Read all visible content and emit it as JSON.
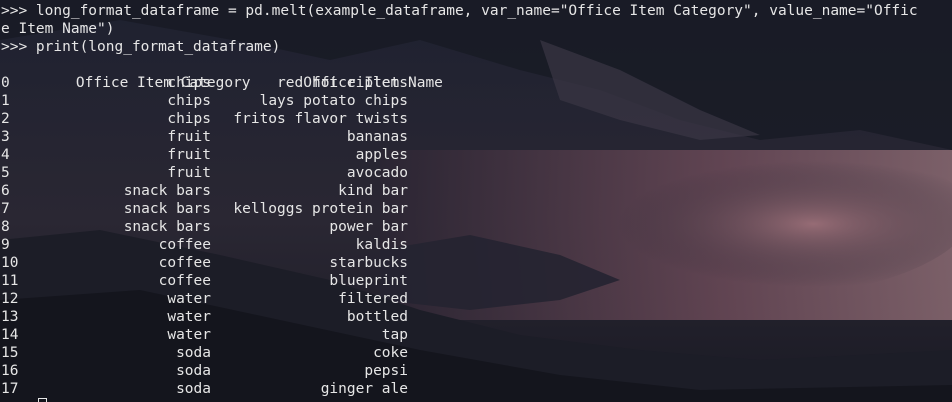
{
  "terminal": {
    "command_1_line_1": ">>> long_format_dataframe = pd.melt(example_dataframe, var_name=\"Office Item Category\", value_name=\"Offic",
    "command_1_line_2": "e Item Name\")",
    "command_2": ">>> print(long_format_dataframe)",
    "columns": [
      "Office Item Category",
      "Office Item Name"
    ],
    "rows": [
      {
        "index": "0",
        "category": "chips",
        "name": "red hot riplets"
      },
      {
        "index": "1",
        "category": "chips",
        "name": "lays potato chips"
      },
      {
        "index": "2",
        "category": "chips",
        "name": "fritos flavor twists"
      },
      {
        "index": "3",
        "category": "fruit",
        "name": "bananas"
      },
      {
        "index": "4",
        "category": "fruit",
        "name": "apples"
      },
      {
        "index": "5",
        "category": "fruit",
        "name": "avocado"
      },
      {
        "index": "6",
        "category": "snack bars",
        "name": "kind bar"
      },
      {
        "index": "7",
        "category": "snack bars",
        "name": "kelloggs protein bar"
      },
      {
        "index": "8",
        "category": "snack bars",
        "name": "power bar"
      },
      {
        "index": "9",
        "category": "coffee",
        "name": "kaldis"
      },
      {
        "index": "10",
        "category": "coffee",
        "name": "starbucks"
      },
      {
        "index": "11",
        "category": "coffee",
        "name": "blueprint"
      },
      {
        "index": "12",
        "category": "water",
        "name": "filtered"
      },
      {
        "index": "13",
        "category": "water",
        "name": "bottled"
      },
      {
        "index": "14",
        "category": "water",
        "name": "tap"
      },
      {
        "index": "15",
        "category": "soda",
        "name": "coke"
      },
      {
        "index": "16",
        "category": "soda",
        "name": "pepsi"
      },
      {
        "index": "17",
        "category": "soda",
        "name": "ginger ale"
      }
    ]
  },
  "colors": {
    "text": "#e6e6e6",
    "background": "#15161f"
  }
}
